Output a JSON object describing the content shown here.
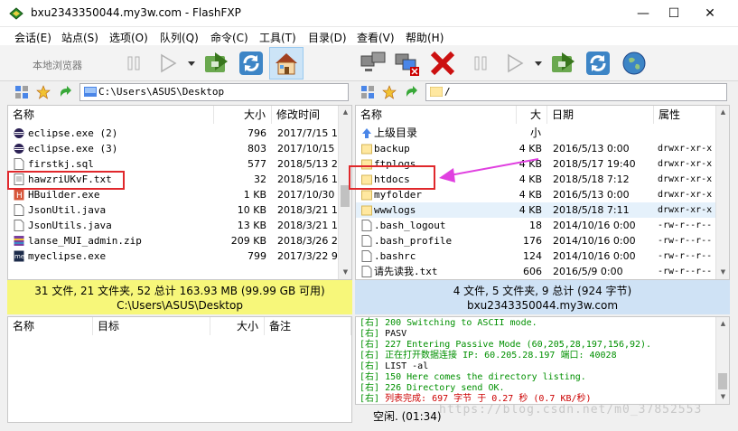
{
  "window": {
    "title": "bxu2343350044.my3w.com - FlashFXP",
    "min": "—",
    "max": "☐",
    "close": "✕"
  },
  "menu": [
    {
      "label": "会话(E)"
    },
    {
      "label": "站点(S)"
    },
    {
      "label": "选项(O)"
    },
    {
      "label": "队列(Q)"
    },
    {
      "label": "命令(C)"
    },
    {
      "label": "工具(T)"
    },
    {
      "label": "目录(D)"
    },
    {
      "label": "查看(V)"
    },
    {
      "label": "帮助(H)"
    }
  ],
  "toolbar": {
    "local_browser_label": "本地浏览器"
  },
  "left_pane": {
    "path": "C:\\Users\\ASUS\\Desktop",
    "columns": {
      "name": "名称",
      "size": "大小",
      "modified": "修改时间"
    },
    "files": [
      {
        "name": "eclipse.exe (2)",
        "size": "796",
        "modified": "2017/7/15 1",
        "icon": "eclipse-icon"
      },
      {
        "name": "eclipse.exe (3)",
        "size": "803",
        "modified": "2017/10/15",
        "icon": "eclipse-icon"
      },
      {
        "name": "firstkj.sql",
        "size": "577",
        "modified": "2018/5/13 2",
        "icon": "file-icon"
      },
      {
        "name": "hawzriUKvF.txt",
        "size": "32",
        "modified": "2018/5/16 1",
        "icon": "text-file-icon"
      },
      {
        "name": "HBuilder.exe",
        "size": "1 KB",
        "modified": "2017/10/30",
        "icon": "hbuilder-icon"
      },
      {
        "name": "JsonUtil.java",
        "size": "10 KB",
        "modified": "2018/3/21 1",
        "icon": "file-icon"
      },
      {
        "name": "JsonUtils.java",
        "size": "13 KB",
        "modified": "2018/3/21 1",
        "icon": "file-icon"
      },
      {
        "name": "lanse_MUI_admin.zip",
        "size": "209 KB",
        "modified": "2018/3/26 2",
        "icon": "archive-icon"
      },
      {
        "name": "myeclipse.exe",
        "size": "799",
        "modified": "2017/3/22 9",
        "icon": "myeclipse-icon"
      }
    ],
    "status_line1": "31 文件, 21 文件夹, 52 总计 163.93 MB (99.99 GB 可用)",
    "status_line2": "C:\\Users\\ASUS\\Desktop"
  },
  "right_pane": {
    "path": "/",
    "columns": {
      "name": "名称",
      "size": "大小",
      "date": "日期",
      "attr": "属性"
    },
    "parent_dir": "上级目录",
    "files": [
      {
        "name": "backup",
        "size": "4 KB",
        "date": "2016/5/13 0:00",
        "attr": "drwxr-xr-x",
        "folder": true
      },
      {
        "name": "ftplogs",
        "size": "4 KB",
        "date": "2018/5/17 19:40",
        "attr": "drwxr-xr-x",
        "folder": true
      },
      {
        "name": "htdocs",
        "size": "4 KB",
        "date": "2018/5/18 7:12",
        "attr": "drwxr-xr-x",
        "folder": true
      },
      {
        "name": "myfolder",
        "size": "4 KB",
        "date": "2016/5/13 0:00",
        "attr": "drwxr-xr-x",
        "folder": true
      },
      {
        "name": "wwwlogs",
        "size": "4 KB",
        "date": "2018/5/18 7:11",
        "attr": "drwxr-xr-x",
        "folder": true,
        "selected": true
      },
      {
        "name": ".bash_logout",
        "size": "18",
        "date": "2014/10/16 0:00",
        "attr": "-rw-r--r--",
        "folder": false
      },
      {
        "name": ".bash_profile",
        "size": "176",
        "date": "2014/10/16 0:00",
        "attr": "-rw-r--r--",
        "folder": false
      },
      {
        "name": ".bashrc",
        "size": "124",
        "date": "2014/10/16 0:00",
        "attr": "-rw-r--r--",
        "folder": false
      },
      {
        "name": "请先读我.txt",
        "size": "606",
        "date": "2016/5/9 0:00",
        "attr": "-rw-r--r--",
        "folder": false
      }
    ],
    "status_line1": "4 文件, 5 文件夹, 9 总计 (924 字节)",
    "status_line2": "bxu2343350044.my3w.com"
  },
  "queue": {
    "columns": {
      "name": "名称",
      "target": "目标",
      "size": "大小",
      "note": "备注"
    }
  },
  "log": {
    "prefix": "[右]",
    "lines": [
      {
        "text": "200 Switching to ASCII mode.",
        "color": "green"
      },
      {
        "text": "PASV",
        "color": "black"
      },
      {
        "text": "227 Entering Passive Mode (60,205,28,197,156,92).",
        "color": "green"
      },
      {
        "text": "正在打开数据连接 IP: 60.205.28.197 端口: 40028",
        "color": "green"
      },
      {
        "text": "LIST -al",
        "color": "black"
      },
      {
        "text": "150 Here comes the directory listing.",
        "color": "green"
      },
      {
        "text": "226 Directory send OK.",
        "color": "green"
      },
      {
        "text": "列表完成: 697 字节 于 0.27 秒 (0.7 KB/秒)",
        "color": "red"
      }
    ]
  },
  "bottom_status": "空闲. (01:34)",
  "watermark": "https://blog.csdn.net/m0_37852553",
  "colors": {
    "annotation_red": "#e0282c",
    "annotation_magenta": "#e040e0",
    "left_status_bg": "#f7f77a",
    "right_status_bg": "#cfe2f5"
  }
}
